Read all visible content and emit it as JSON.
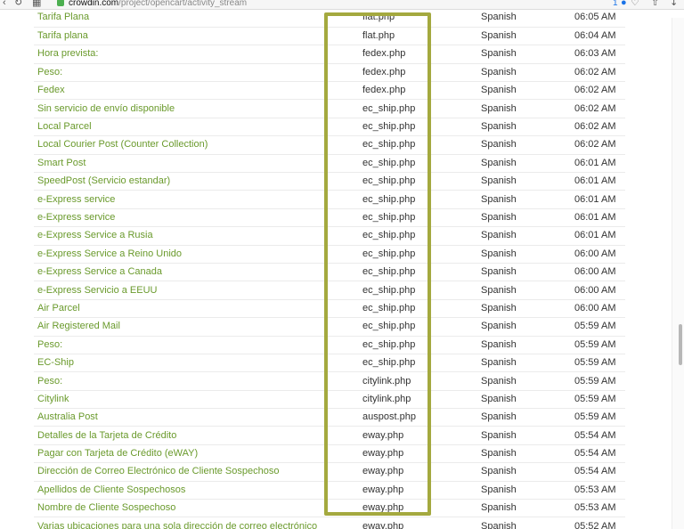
{
  "browser": {
    "url_domain": "crowdin.com",
    "url_path": "/project/opencart/activity_stream",
    "badge_count": "1",
    "icons": [
      "back-icon",
      "forward-icon",
      "refresh-icon",
      "grid-icon",
      "lock-icon",
      "shield-icon",
      "heart-icon",
      "share-icon",
      "download-icon"
    ]
  },
  "activity": [
    {
      "text": "Tarifa Plana",
      "file": "flat.php",
      "language": "Spanish",
      "time": "06:05 AM"
    },
    {
      "text": "Tarifa plana",
      "file": "flat.php",
      "language": "Spanish",
      "time": "06:04 AM"
    },
    {
      "text": "Hora prevista:",
      "file": "fedex.php",
      "language": "Spanish",
      "time": "06:03 AM"
    },
    {
      "text": "Peso:",
      "file": "fedex.php",
      "language": "Spanish",
      "time": "06:02 AM"
    },
    {
      "text": "Fedex",
      "file": "fedex.php",
      "language": "Spanish",
      "time": "06:02 AM"
    },
    {
      "text": "Sin servicio de envío disponible",
      "file": "ec_ship.php",
      "language": "Spanish",
      "time": "06:02 AM"
    },
    {
      "text": "Local Parcel",
      "file": "ec_ship.php",
      "language": "Spanish",
      "time": "06:02 AM"
    },
    {
      "text": "Local Courier Post (Counter Collection)",
      "file": "ec_ship.php",
      "language": "Spanish",
      "time": "06:02 AM"
    },
    {
      "text": "Smart Post",
      "file": "ec_ship.php",
      "language": "Spanish",
      "time": "06:01 AM"
    },
    {
      "text": "SpeedPost (Servicio estandar)",
      "file": "ec_ship.php",
      "language": "Spanish",
      "time": "06:01 AM"
    },
    {
      "text": "e-Express service",
      "file": "ec_ship.php",
      "language": "Spanish",
      "time": "06:01 AM"
    },
    {
      "text": "e-Express service",
      "file": "ec_ship.php",
      "language": "Spanish",
      "time": "06:01 AM"
    },
    {
      "text": "e-Express Service a Rusia",
      "file": "ec_ship.php",
      "language": "Spanish",
      "time": "06:01 AM"
    },
    {
      "text": "e-Express Service a Reino Unido",
      "file": "ec_ship.php",
      "language": "Spanish",
      "time": "06:00 AM"
    },
    {
      "text": "e-Express Service a Canada",
      "file": "ec_ship.php",
      "language": "Spanish",
      "time": "06:00 AM"
    },
    {
      "text": "e-Express Servicio a EEUU",
      "file": "ec_ship.php",
      "language": "Spanish",
      "time": "06:00 AM"
    },
    {
      "text": "Air Parcel",
      "file": "ec_ship.php",
      "language": "Spanish",
      "time": "06:00 AM"
    },
    {
      "text": "Air Registered Mail",
      "file": "ec_ship.php",
      "language": "Spanish",
      "time": "05:59 AM"
    },
    {
      "text": "Peso:",
      "file": "ec_ship.php",
      "language": "Spanish",
      "time": "05:59 AM"
    },
    {
      "text": "EC-Ship",
      "file": "ec_ship.php",
      "language": "Spanish",
      "time": "05:59 AM"
    },
    {
      "text": "Peso:",
      "file": "citylink.php",
      "language": "Spanish",
      "time": "05:59 AM"
    },
    {
      "text": "Citylink",
      "file": "citylink.php",
      "language": "Spanish",
      "time": "05:59 AM"
    },
    {
      "text": "Australia Post",
      "file": "auspost.php",
      "language": "Spanish",
      "time": "05:59 AM"
    },
    {
      "text": "Detalles de la Tarjeta de Crédito",
      "file": "eway.php",
      "language": "Spanish",
      "time": "05:54 AM"
    },
    {
      "text": "Pagar con Tarjeta de Crédito (eWAY)",
      "file": "eway.php",
      "language": "Spanish",
      "time": "05:54 AM"
    },
    {
      "text": "Dirección de Correo Electrónico de Cliente Sospechoso",
      "file": "eway.php",
      "language": "Spanish",
      "time": "05:54 AM"
    },
    {
      "text": "Apellidos de Cliente Sospechosos",
      "file": "eway.php",
      "language": "Spanish",
      "time": "05:53 AM"
    },
    {
      "text": "Nombre de Cliente Sospechoso",
      "file": "eway.php",
      "language": "Spanish",
      "time": "05:53 AM"
    },
    {
      "text": "Varias ubicaciones para una sola dirección de correo electrónico",
      "file": "eway.php",
      "language": "Spanish",
      "time": "05:52 AM"
    }
  ],
  "colors": {
    "link_green": "#6a9a2c",
    "highlight_border": "#a4a93f"
  }
}
